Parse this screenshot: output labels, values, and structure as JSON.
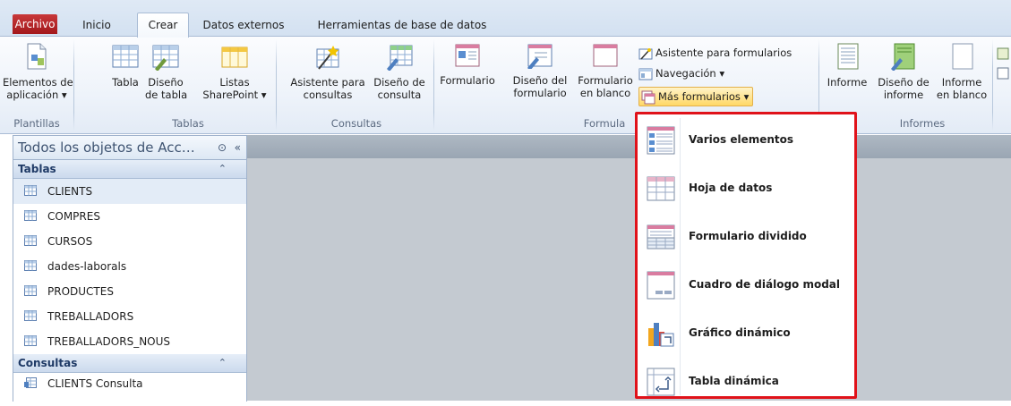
{
  "tabs": [
    "Archivo",
    "Inicio",
    "Crear",
    "Datos externos",
    "Herramientas de base de datos"
  ],
  "ribbon": {
    "plantillas": {
      "button": [
        "Elementos de",
        "aplicación ▾"
      ],
      "label": "Plantillas"
    },
    "tablas": {
      "tabla": "Tabla",
      "diseno": [
        "Diseño",
        "de tabla"
      ],
      "listas": [
        "Listas",
        "SharePoint ▾"
      ],
      "label": "Tablas"
    },
    "consultas": {
      "asistente": [
        "Asistente para",
        "consultas"
      ],
      "diseno": [
        "Diseño de",
        "consulta"
      ],
      "label": "Consultas"
    },
    "formularios": {
      "formulario": "Formulario",
      "diseno": [
        "Diseño del",
        "formulario"
      ],
      "blanco": [
        "Formulario",
        "en blanco"
      ],
      "asistente": "Asistente para formularios",
      "navegacion": "Navegación ▾",
      "mas": "Más formularios ▾",
      "label": "Formula"
    },
    "informes": {
      "informe": "Informe",
      "diseno": [
        "Diseño de",
        "informe"
      ],
      "blanco": [
        "Informe",
        "en blanco"
      ],
      "label": "Informes"
    }
  },
  "nav": {
    "title": "Todos los objetos de Acc…",
    "tables_header": "Tablas",
    "tables": [
      "CLIENTS",
      "COMPRES",
      "CURSOS",
      "dades-laborals",
      "PRODUCTES",
      "TREBALLADORS",
      "TREBALLADORS_NOUS"
    ],
    "queries_header": "Consultas",
    "queries": [
      "CLIENTS Consulta"
    ]
  },
  "menu": {
    "items": [
      {
        "label": "Varios elementos",
        "icon": "multiple-items-icon"
      },
      {
        "label": "Hoja de datos",
        "icon": "datasheet-icon"
      },
      {
        "label": "Formulario dividido",
        "icon": "split-form-icon"
      },
      {
        "label": "Cuadro de diálogo modal",
        "icon": "modal-dialog-icon"
      },
      {
        "label": "Gráfico dinámico",
        "icon": "pivot-chart-icon"
      },
      {
        "label": "Tabla dinámica",
        "icon": "pivot-table-icon"
      }
    ]
  },
  "colors": {
    "accent_red": "#e0121a",
    "file_tab": "#b5262a",
    "ribbon_border": "#a9bcd5"
  }
}
